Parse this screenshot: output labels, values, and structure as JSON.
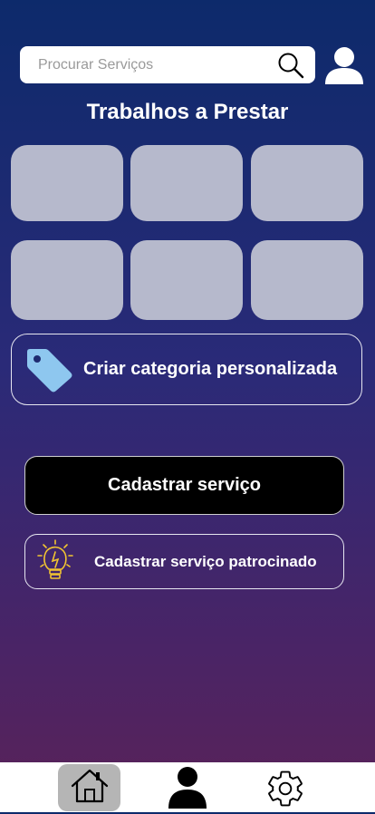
{
  "search": {
    "placeholder": "Procurar Serviços",
    "value": ""
  },
  "header": {
    "title": "Trabalhos a Prestar"
  },
  "categories": [
    {
      "label": ""
    },
    {
      "label": ""
    },
    {
      "label": ""
    },
    {
      "label": ""
    },
    {
      "label": ""
    },
    {
      "label": ""
    }
  ],
  "custom_category": {
    "label": "Criar categoria personalizada",
    "icon": "tag-icon"
  },
  "actions": {
    "register_label": "Cadastrar serviço",
    "sponsored_label": "Cadastrar serviço patrocinado",
    "sponsored_icon": "lightbulb-icon"
  },
  "nav": {
    "items": [
      {
        "icon": "home-icon",
        "active": true
      },
      {
        "icon": "user-icon",
        "active": false
      },
      {
        "icon": "gear-icon",
        "active": false
      }
    ]
  },
  "colors": {
    "tile": "#b6b9cc",
    "tag": "#8ec7ef",
    "bulb": "#f2c531",
    "active_nav": "#b5b5b5"
  }
}
